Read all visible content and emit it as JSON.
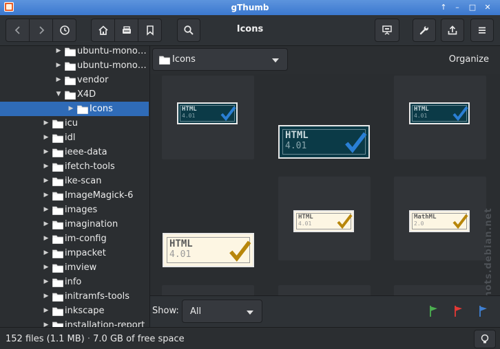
{
  "window": {
    "title": "gThumb"
  },
  "header": {
    "title": "Icons"
  },
  "sidebar": {
    "items": [
      {
        "label": "ubuntu-mono…",
        "expanded": false
      },
      {
        "label": "ubuntu-mono…",
        "expanded": false
      },
      {
        "label": "vendor",
        "expanded": false
      },
      {
        "label": "X4D",
        "expanded": true
      },
      {
        "label": "Icons",
        "selected": true
      },
      {
        "label": "icu"
      },
      {
        "label": "idl"
      },
      {
        "label": "ieee-data"
      },
      {
        "label": "ifetch-tools"
      },
      {
        "label": "ike-scan"
      },
      {
        "label": "ImageMagick-6"
      },
      {
        "label": "images"
      },
      {
        "label": "imagination"
      },
      {
        "label": "im-config"
      },
      {
        "label": "impacket"
      },
      {
        "label": "imview"
      },
      {
        "label": "info"
      },
      {
        "label": "initramfs-tools"
      },
      {
        "label": "inkscape"
      },
      {
        "label": "installation-report"
      }
    ]
  },
  "location": {
    "label": "Icons",
    "organize_label": "Organize"
  },
  "thumbnails": [
    {
      "line1": "HTML",
      "line2": "4.01",
      "theme": "dark"
    },
    {
      "line1": "HTML",
      "line2": "4.01",
      "theme": "dark"
    },
    {
      "line1": "HTML",
      "line2": "4.01",
      "theme": "dark"
    },
    {
      "line1": "HTML",
      "line2": "4.01",
      "theme": "light"
    },
    {
      "line1": "MathML",
      "line2": "2.0",
      "theme": "light"
    },
    {
      "line1": "HTML",
      "line2": "4.01",
      "theme": "light"
    }
  ],
  "watermark": "screenshots.debian.net",
  "filter": {
    "show_label": "Show:",
    "show_value": "All"
  },
  "status": {
    "files": "152 files (1.1 MB)",
    "separator": "·",
    "free_space": "7.0 GB of free space"
  },
  "colors": {
    "accent": "#2f6bb7",
    "titlebar": "#4a86d6",
    "check_blue": "#2a7fd4",
    "check_gold": "#b8860b"
  }
}
